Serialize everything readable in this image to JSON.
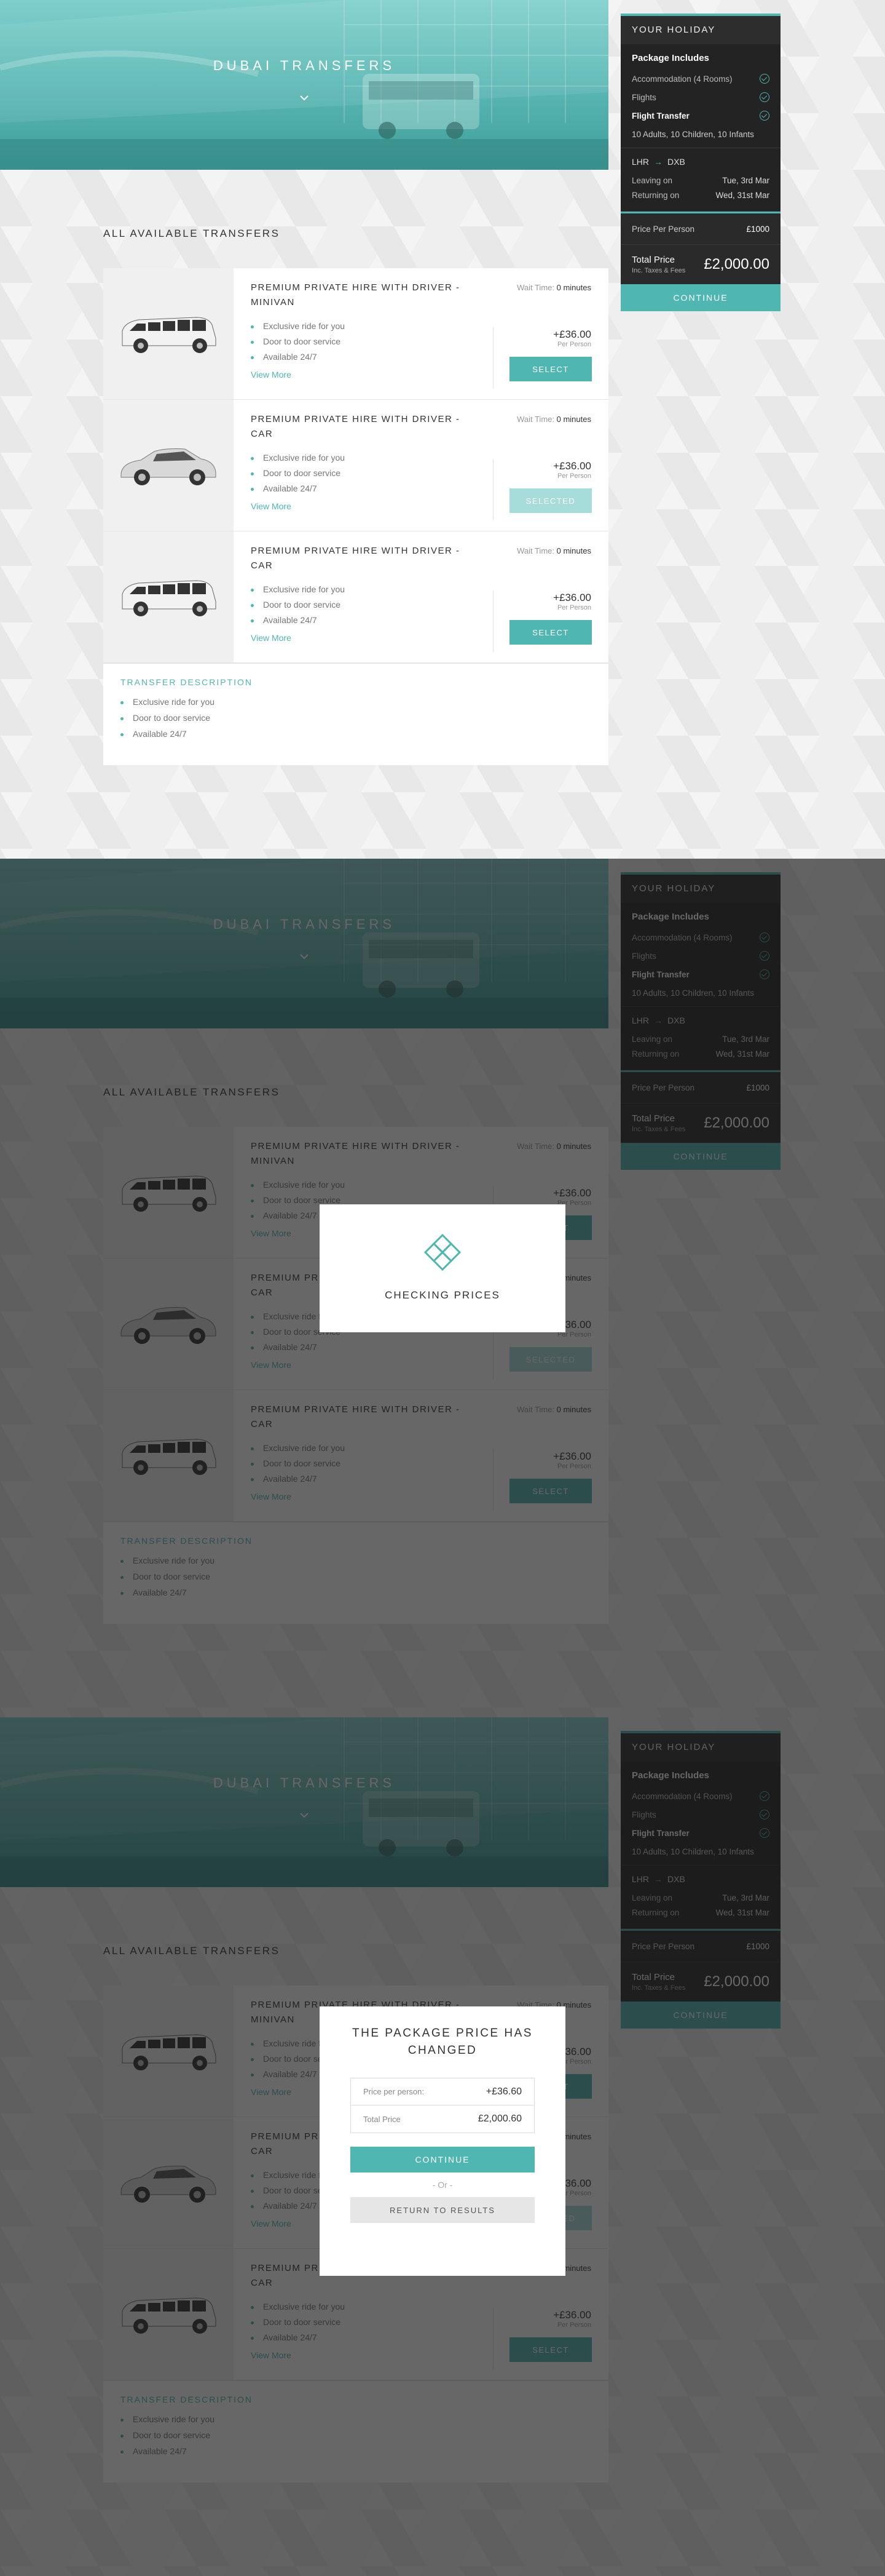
{
  "hero": {
    "title": "DUBAI TRANSFERS"
  },
  "section_title": "ALL AVAILABLE TRANSFERS",
  "sidebar": {
    "heading": "YOUR HOLIDAY",
    "includes_title": "Package Includes",
    "includes": [
      {
        "label": "Accommodation (4 Rooms)",
        "bold": false
      },
      {
        "label": "Flights",
        "bold": false
      },
      {
        "label": "Flight Transfer",
        "bold": true
      }
    ],
    "pax": "10 Adults, 10 Children, 10 Infants",
    "route_from": "LHR",
    "route_to": "DXB",
    "leaving_label": "Leaving on",
    "leaving_date": "Tue, 3rd Mar",
    "returning_label": "Returning on",
    "returning_date": "Wed, 31st Mar",
    "ppp_label": "Price Per Person",
    "ppp_value": "£1000",
    "total_label": "Total Price",
    "total_sub": "Inc. Taxes & Fees",
    "total_value": "£2,000.00",
    "continue": "CONTINUE"
  },
  "transfers": [
    {
      "name": "PREMIUM PRIVATE HIRE WITH DRIVER - MINIVAN",
      "vehicle": "minivan",
      "wait_label": "Wait Time:",
      "wait_value": "0 minutes",
      "features": [
        "Exclusive ride for you",
        "Door to door service",
        "Available 24/7"
      ],
      "view_more": "View More",
      "price": "+£36.00",
      "per": "Per Person",
      "button": "SELECT",
      "selected": false
    },
    {
      "name": "PREMIUM PRIVATE HIRE WITH DRIVER - CAR",
      "vehicle": "car",
      "wait_label": "Wait Time:",
      "wait_value": "0 minutes",
      "features": [
        "Exclusive ride for you",
        "Door to door service",
        "Available 24/7"
      ],
      "view_more": "View More",
      "price": "+£36.00",
      "per": "Per Person",
      "button": "SELECTED",
      "selected": true
    },
    {
      "name": "PREMIUM PRIVATE HIRE WITH DRIVER - CAR",
      "vehicle": "minivan",
      "wait_label": "Wait Time:",
      "wait_value": "0 minutes",
      "features": [
        "Exclusive ride for you",
        "Door to door service",
        "Available 24/7"
      ],
      "view_more": "View More",
      "price": "+£36.00",
      "per": "Per Person",
      "button": "SELECT",
      "selected": false
    }
  ],
  "description": {
    "title": "TRANSFER DESCRIPTION",
    "items": [
      "Exclusive ride for you",
      "Door to door service",
      "Available 24/7"
    ]
  },
  "checking_modal": {
    "message": "CHECKING PRICES",
    "icon": "diamond-loader-icon"
  },
  "price_modal": {
    "title": "THE PACKAGE PRICE HAS CHANGED",
    "rows": [
      {
        "label": "Price per person:",
        "value": "+£36.60"
      },
      {
        "label": "Total Price",
        "value": "£2,000.60"
      }
    ],
    "continue": "CONTINUE",
    "or": "Or",
    "return": "RETURN TO RESULTS"
  },
  "colors": {
    "accent": "#4fb6b2",
    "sidebar_bg": "#232323",
    "overlay": "rgba(25,25,25,0.66)"
  }
}
